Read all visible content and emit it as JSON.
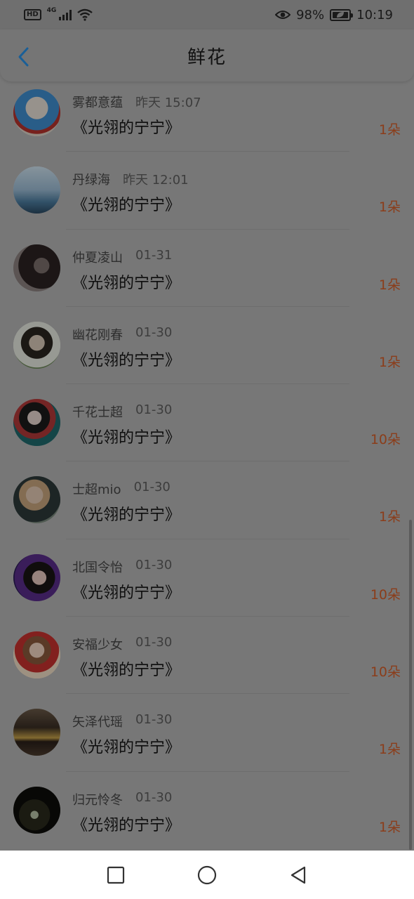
{
  "status": {
    "hd": "HD",
    "network": "4G",
    "battery": "98%",
    "time": "10:19"
  },
  "header": {
    "title": "鲜花",
    "back_icon": "chevron-left-icon",
    "accent": "#1e88e5"
  },
  "colors": {
    "count": "#8b3d1a",
    "overlay": "#777777"
  },
  "records": [
    {
      "name": "雾都意蕴",
      "time": "昨天 15:07",
      "book": "《光翎的宁宁》",
      "count": "1朵"
    },
    {
      "name": "丹绿海",
      "time": "昨天 12:01",
      "book": "《光翎的宁宁》",
      "count": "1朵"
    },
    {
      "name": "仲夏凌山",
      "time": "01-31",
      "book": "《光翎的宁宁》",
      "count": "1朵"
    },
    {
      "name": "幽花刚春",
      "time": "01-30",
      "book": "《光翎的宁宁》",
      "count": "1朵"
    },
    {
      "name": "千花士超",
      "time": "01-30",
      "book": "《光翎的宁宁》",
      "count": "10朵"
    },
    {
      "name": "士超mio",
      "time": "01-30",
      "book": "《光翎的宁宁》",
      "count": "1朵"
    },
    {
      "name": "北国令怡",
      "time": "01-30",
      "book": "《光翎的宁宁》",
      "count": "10朵"
    },
    {
      "name": "安福少女",
      "time": "01-30",
      "book": "《光翎的宁宁》",
      "count": "10朵"
    },
    {
      "name": "矢泽代瑶",
      "time": "01-30",
      "book": "《光翎的宁宁》",
      "count": "1朵"
    },
    {
      "name": "归元怜冬",
      "time": "01-30",
      "book": "《光翎的宁宁》",
      "count": "1朵"
    }
  ],
  "navbar": {
    "recents_icon": "square-icon",
    "home_icon": "circle-icon",
    "back_icon": "triangle-back-icon"
  }
}
